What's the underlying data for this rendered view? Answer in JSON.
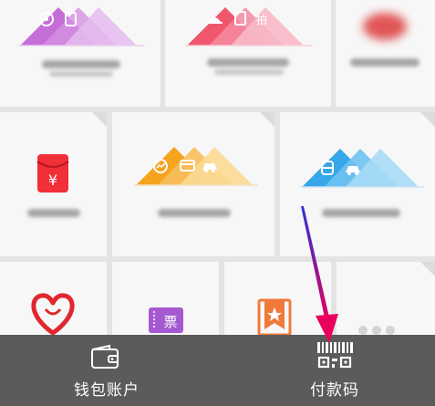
{
  "grid": {
    "tiles": [
      {
        "id": "movie-tickets",
        "icons": [
          "film-reel-icon",
          "tag-icon"
        ],
        "color": "#c266d6"
      },
      {
        "id": "food-services",
        "icons": [
          "dish-icon",
          "menu-icon",
          "pai-badge-icon"
        ],
        "color": "#f0576f"
      },
      {
        "id": "blurred-service",
        "color": "#dd3b3b"
      },
      {
        "id": "red-envelope",
        "icon": "red-envelope-icon",
        "glyph": "¥",
        "color": "#f12f39"
      },
      {
        "id": "finance-services",
        "icons": [
          "growth-chart-icon",
          "card-icon",
          "car-icon"
        ],
        "color": "#f6a31e"
      },
      {
        "id": "travel-services",
        "icons": [
          "train-icon",
          "taxi-icon"
        ],
        "color": "#36a7e8"
      },
      {
        "id": "charity",
        "icon": "heart-icon",
        "color": "#e0282e"
      },
      {
        "id": "tickets",
        "icon": "ticket-icon",
        "glyph": "票",
        "color": "#a559d0"
      },
      {
        "id": "membership",
        "icon": "star-bookmark-icon",
        "color": "#f07a3b"
      },
      {
        "id": "more",
        "icon": "more-dots-icon",
        "color": "#d4d4d4"
      }
    ]
  },
  "bottom_bar": {
    "wallet": {
      "label": "钱包账户",
      "icon": "wallet-icon"
    },
    "pay_code": {
      "label": "付款码",
      "icon": "qr-code-icon"
    }
  },
  "annotation": {
    "icon": "pointer-arrow-icon",
    "color": "#e8005c"
  }
}
